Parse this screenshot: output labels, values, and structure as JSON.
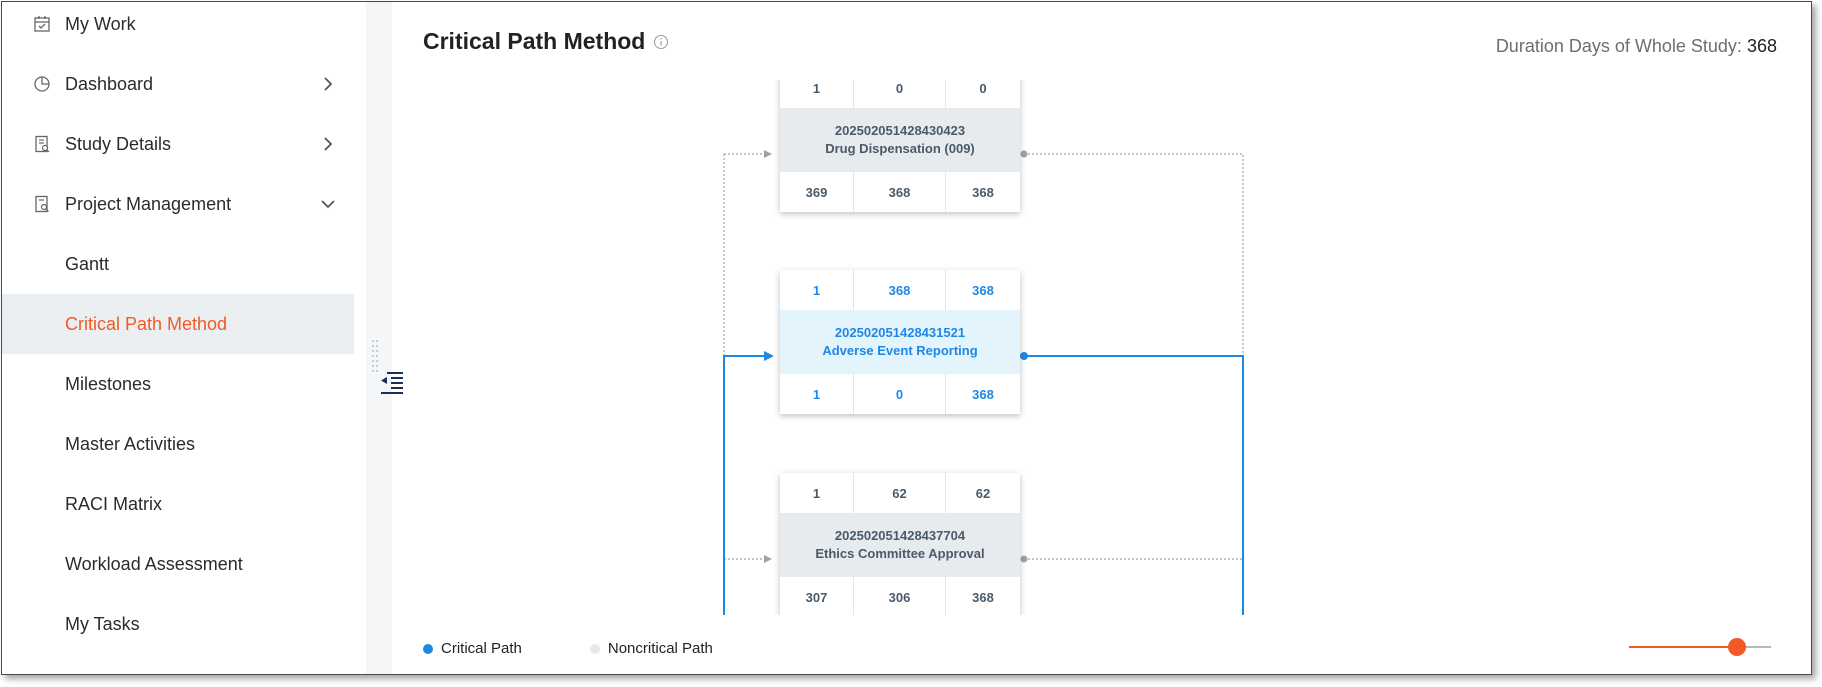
{
  "sidebar": {
    "items": [
      {
        "label": "My Work",
        "icon": "calendar-check-icon"
      },
      {
        "label": "Dashboard",
        "icon": "pie-chart-icon",
        "chevron": "right"
      },
      {
        "label": "Study Details",
        "icon": "document-search-icon",
        "chevron": "right"
      },
      {
        "label": "Project Management",
        "icon": "document-magnify-icon",
        "chevron": "down"
      },
      {
        "label": "Gantt"
      },
      {
        "label": "Critical Path Method",
        "active": true
      },
      {
        "label": "Milestones"
      },
      {
        "label": "Master Activities"
      },
      {
        "label": "RACI Matrix"
      },
      {
        "label": "Workload Assessment"
      },
      {
        "label": "My Tasks"
      }
    ]
  },
  "header": {
    "title": "Critical Path Method",
    "duration_label": "Duration Days of Whole Study:",
    "duration_value": "368"
  },
  "nodes": [
    {
      "id": "202502051428430423",
      "name": "Drug Dispensation (009)",
      "critical": false,
      "top": [
        "1",
        "0",
        "0"
      ],
      "bottom": [
        "369",
        "368",
        "368"
      ]
    },
    {
      "id": "202502051428431521",
      "name": "Adverse Event Reporting",
      "critical": true,
      "top": [
        "1",
        "368",
        "368"
      ],
      "bottom": [
        "1",
        "0",
        "368"
      ]
    },
    {
      "id": "202502051428437704",
      "name": "Ethics Committee Approval",
      "critical": false,
      "top": [
        "1",
        "62",
        "62"
      ],
      "bottom": [
        "307",
        "306",
        "368"
      ]
    }
  ],
  "legend": {
    "critical_label": "Critical Path",
    "noncritical_label": "Noncritical Path"
  },
  "zoom": {
    "level": 0.8
  },
  "colors": {
    "accent": "#f15a24",
    "critical": "#1e88e5",
    "noncritical": "#e8e8e8",
    "connector_noncritical": "#9aa4ad"
  }
}
